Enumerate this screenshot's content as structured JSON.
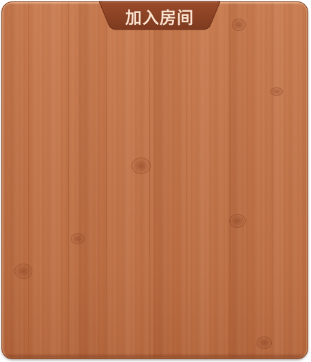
{
  "dialog": {
    "title": "加入房间"
  },
  "colors": {
    "wood_base": "#c27449",
    "wood_border": "#8a4a28",
    "title_tab": "#8e4426",
    "title_text": "#fbe3cf"
  }
}
